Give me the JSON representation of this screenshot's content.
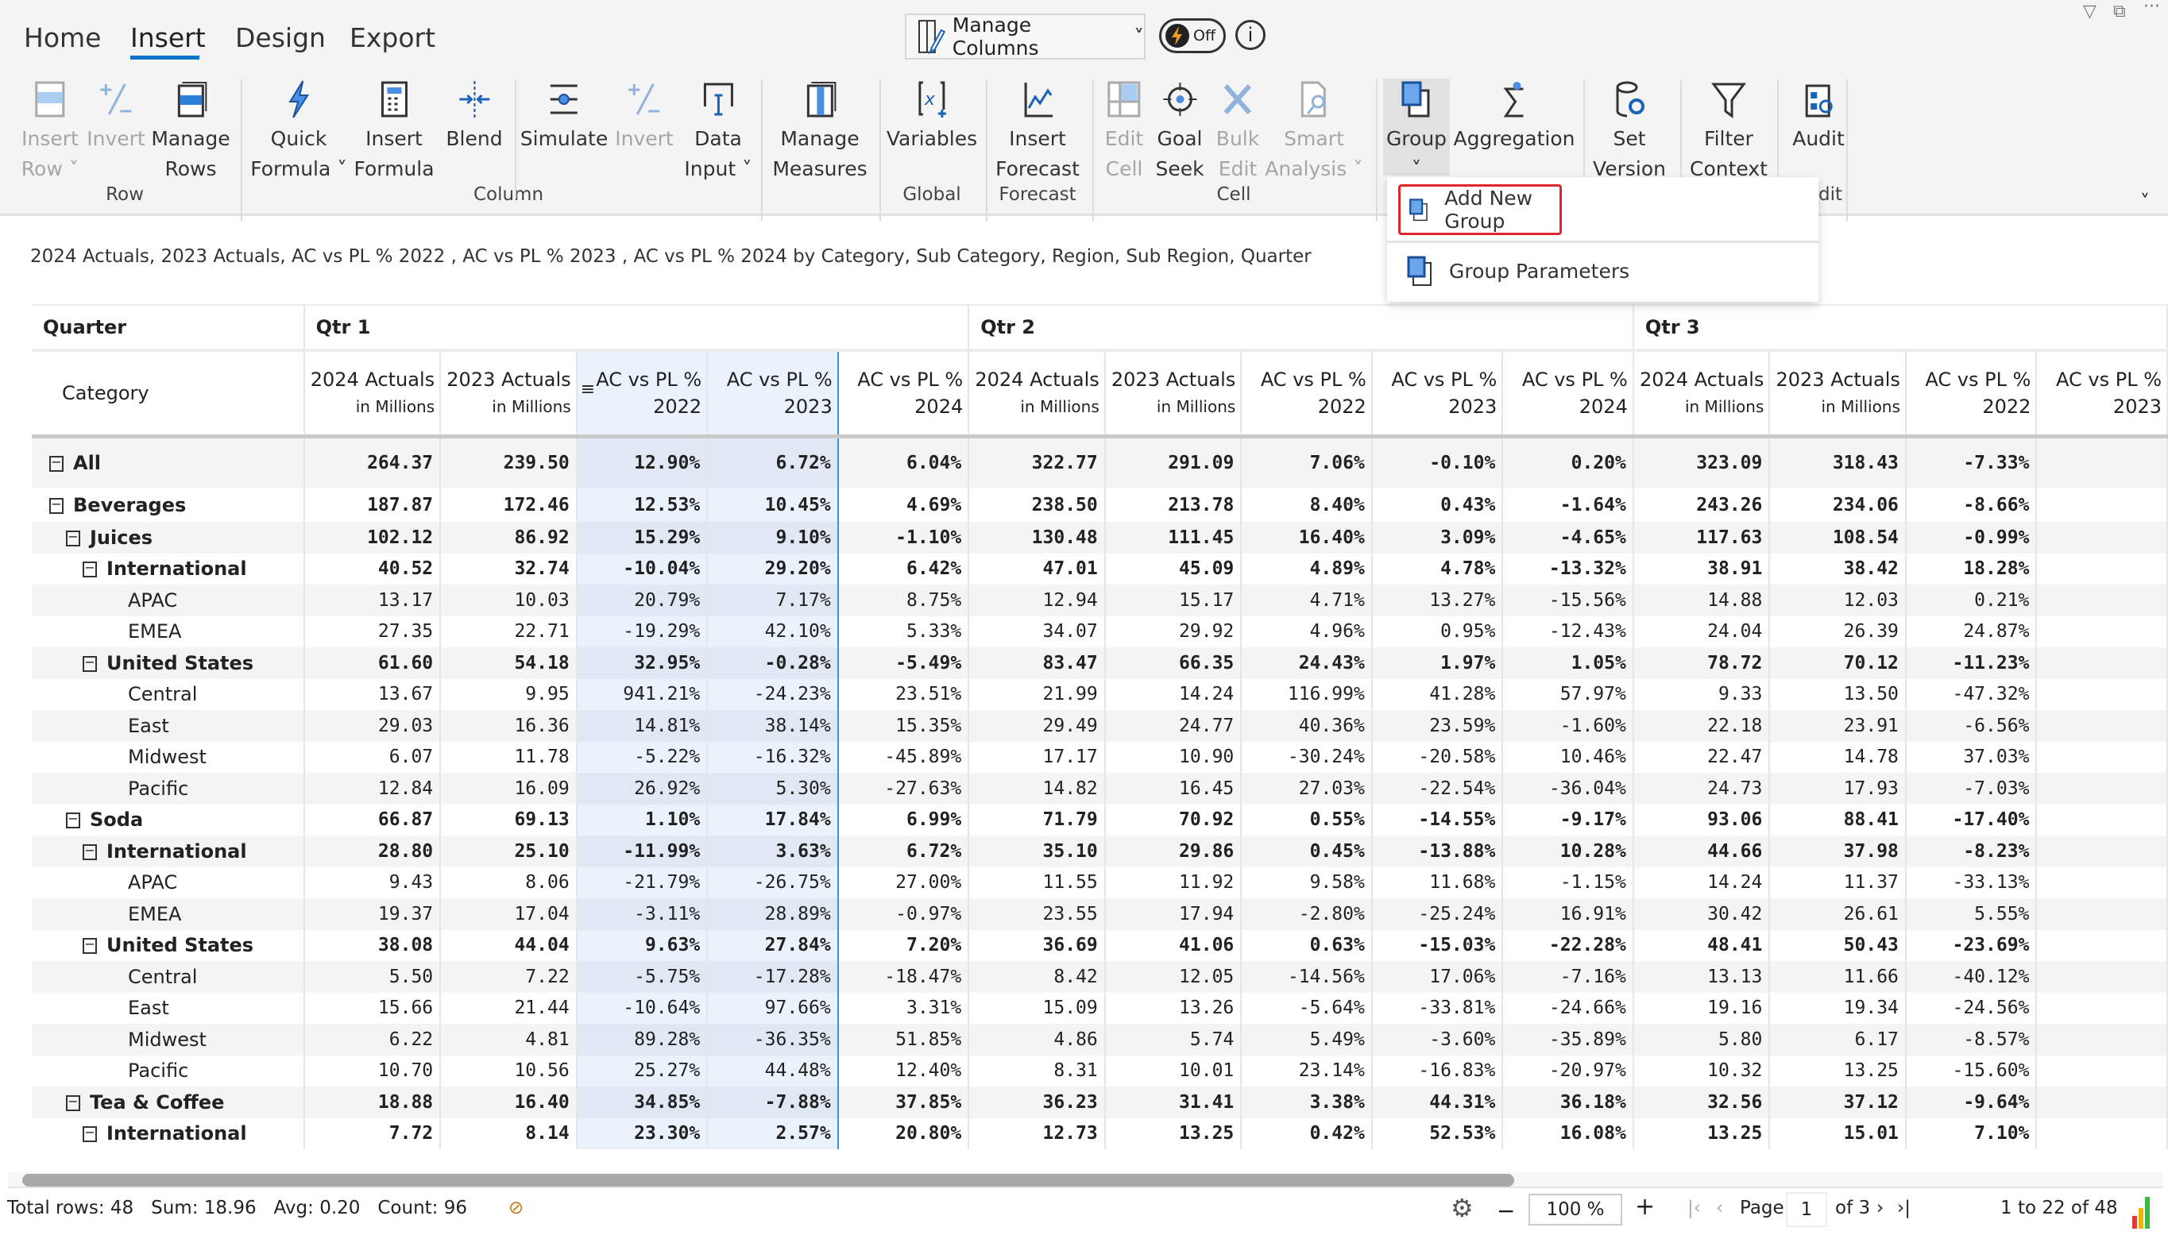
{
  "tabs": [
    "Home",
    "Insert",
    "Design",
    "Export"
  ],
  "active_tab": "Insert",
  "toolbar": {
    "manage_columns": "Manage Columns",
    "toggle_label": "Off",
    "info": "i"
  },
  "ribbon": {
    "buttons": [
      {
        "l1": "Insert",
        "l2": "Row ˅",
        "icon": "insert-row-icon",
        "disabled": true
      },
      {
        "l1": "Invert",
        "l2": "",
        "icon": "invert-icon",
        "disabled": true
      },
      {
        "l1": "Manage",
        "l2": "Rows",
        "icon": "manage-rows-icon",
        "disabled": false
      },
      {
        "l1": "Quick",
        "l2": "Formula ˅",
        "icon": "lightning-icon",
        "disabled": false
      },
      {
        "l1": "Insert",
        "l2": "Formula",
        "icon": "calculator-icon",
        "disabled": false
      },
      {
        "l1": "Blend",
        "l2": "",
        "icon": "blend-icon",
        "disabled": false
      },
      {
        "l1": "Simulate",
        "l2": "",
        "icon": "simulate-icon",
        "disabled": false
      },
      {
        "l1": "Invert",
        "l2": "",
        "icon": "invert-icon",
        "disabled": true
      },
      {
        "l1": "Data",
        "l2": "Input ˅",
        "icon": "data-input-icon",
        "disabled": false
      },
      {
        "l1": "Manage",
        "l2": "Measures",
        "icon": "manage-measures-icon",
        "disabled": false
      },
      {
        "l1": "Variables",
        "l2": "",
        "icon": "variables-icon",
        "disabled": false
      },
      {
        "l1": "Insert",
        "l2": "Forecast",
        "icon": "forecast-icon",
        "disabled": false
      },
      {
        "l1": "Edit",
        "l2": "Cell",
        "icon": "edit-cell-icon",
        "disabled": true
      },
      {
        "l1": "Goal",
        "l2": "Seek",
        "icon": "goal-seek-icon",
        "disabled": false
      },
      {
        "l1": "Bulk",
        "l2": "Edit",
        "icon": "bulk-edit-icon",
        "disabled": true
      },
      {
        "l1": "Smart",
        "l2": "Analysis ˅",
        "icon": "smart-analysis-icon",
        "disabled": true
      },
      {
        "l1": "Group",
        "l2": "˅",
        "icon": "group-icon",
        "disabled": false
      },
      {
        "l1": "Aggregation",
        "l2": "",
        "icon": "aggregation-icon",
        "disabled": false
      },
      {
        "l1": "Set",
        "l2": "Version",
        "icon": "set-version-icon",
        "disabled": false
      },
      {
        "l1": "Filter",
        "l2": "Context",
        "icon": "filter-icon",
        "disabled": false
      },
      {
        "l1": "Audit",
        "l2": "",
        "icon": "audit-icon",
        "disabled": false
      }
    ],
    "groups": [
      "Row",
      "Column",
      "Global",
      "Forecast",
      "Cell",
      "dit"
    ]
  },
  "dropdown": {
    "items": [
      "Add New Group",
      "Group Parameters"
    ]
  },
  "subtitle": "2024 Actuals, 2023 Actuals, AC vs PL % 2022 , AC vs PL % 2023 , AC vs PL % 2024 by Category, Sub Category, Region, Sub Region, Quarter",
  "table": {
    "row_header_top": "Quarter",
    "row_header": "Category",
    "quarters": [
      "Qtr 1",
      "Qtr 2",
      "Qtr 3"
    ],
    "columns": [
      {
        "l1": "2024 Actuals",
        "l2": "in Millions"
      },
      {
        "l1": "2023 Actuals",
        "l2": "in Millions"
      },
      {
        "l1": "AC vs PL %",
        "l2": "2022"
      },
      {
        "l1": "AC vs PL %",
        "l2": "2023"
      },
      {
        "l1": "AC vs PL %",
        "l2": "2024"
      }
    ],
    "rows": [
      {
        "label": "All",
        "level": 0,
        "bold": true,
        "exp": true,
        "v": [
          "264.37",
          "239.50",
          "12.90%",
          "6.72%",
          "6.04%",
          "322.77",
          "291.09",
          "7.06%",
          "-0.10%",
          "0.20%",
          "323.09",
          "318.43",
          "-7.33%"
        ]
      },
      {
        "label": "Beverages",
        "level": 0,
        "bold": true,
        "exp": true,
        "v": [
          "187.87",
          "172.46",
          "12.53%",
          "10.45%",
          "4.69%",
          "238.50",
          "213.78",
          "8.40%",
          "0.43%",
          "-1.64%",
          "243.26",
          "234.06",
          "-8.66%"
        ]
      },
      {
        "label": "Juices",
        "level": 1,
        "bold": true,
        "exp": true,
        "v": [
          "102.12",
          "86.92",
          "15.29%",
          "9.10%",
          "-1.10%",
          "130.48",
          "111.45",
          "16.40%",
          "3.09%",
          "-4.65%",
          "117.63",
          "108.54",
          "-0.99%"
        ]
      },
      {
        "label": "International",
        "level": 2,
        "bold": true,
        "exp": true,
        "v": [
          "40.52",
          "32.74",
          "-10.04%",
          "29.20%",
          "6.42%",
          "47.01",
          "45.09",
          "4.89%",
          "4.78%",
          "-13.32%",
          "38.91",
          "38.42",
          "18.28%"
        ]
      },
      {
        "label": "APAC",
        "level": 3,
        "bold": false,
        "exp": false,
        "v": [
          "13.17",
          "10.03",
          "20.79%",
          "7.17%",
          "8.75%",
          "12.94",
          "15.17",
          "4.71%",
          "13.27%",
          "-15.56%",
          "14.88",
          "12.03",
          "0.21%"
        ]
      },
      {
        "label": "EMEA",
        "level": 3,
        "bold": false,
        "exp": false,
        "v": [
          "27.35",
          "22.71",
          "-19.29%",
          "42.10%",
          "5.33%",
          "34.07",
          "29.92",
          "4.96%",
          "0.95%",
          "-12.43%",
          "24.04",
          "26.39",
          "24.87%"
        ]
      },
      {
        "label": "United States",
        "level": 2,
        "bold": true,
        "exp": true,
        "v": [
          "61.60",
          "54.18",
          "32.95%",
          "-0.28%",
          "-5.49%",
          "83.47",
          "66.35",
          "24.43%",
          "1.97%",
          "1.05%",
          "78.72",
          "70.12",
          "-11.23%"
        ]
      },
      {
        "label": "Central",
        "level": 3,
        "bold": false,
        "exp": false,
        "v": [
          "13.67",
          "9.95",
          "941.21%",
          "-24.23%",
          "23.51%",
          "21.99",
          "14.24",
          "116.99%",
          "41.28%",
          "57.97%",
          "9.33",
          "13.50",
          "-47.32%"
        ]
      },
      {
        "label": "East",
        "level": 3,
        "bold": false,
        "exp": false,
        "v": [
          "29.03",
          "16.36",
          "14.81%",
          "38.14%",
          "15.35%",
          "29.49",
          "24.77",
          "40.36%",
          "23.59%",
          "-1.60%",
          "22.18",
          "23.91",
          "-6.56%"
        ]
      },
      {
        "label": "Midwest",
        "level": 3,
        "bold": false,
        "exp": false,
        "v": [
          "6.07",
          "11.78",
          "-5.22%",
          "-16.32%",
          "-45.89%",
          "17.17",
          "10.90",
          "-30.24%",
          "-20.58%",
          "10.46%",
          "22.47",
          "14.78",
          "37.03%"
        ]
      },
      {
        "label": "Pacific",
        "level": 3,
        "bold": false,
        "exp": false,
        "v": [
          "12.84",
          "16.09",
          "26.92%",
          "5.30%",
          "-27.63%",
          "14.82",
          "16.45",
          "27.03%",
          "-22.54%",
          "-36.04%",
          "24.73",
          "17.93",
          "-7.03%"
        ]
      },
      {
        "label": "Soda",
        "level": 1,
        "bold": true,
        "exp": true,
        "v": [
          "66.87",
          "69.13",
          "1.10%",
          "17.84%",
          "6.99%",
          "71.79",
          "70.92",
          "0.55%",
          "-14.55%",
          "-9.17%",
          "93.06",
          "88.41",
          "-17.40%"
        ]
      },
      {
        "label": "International",
        "level": 2,
        "bold": true,
        "exp": true,
        "v": [
          "28.80",
          "25.10",
          "-11.99%",
          "3.63%",
          "6.72%",
          "35.10",
          "29.86",
          "0.45%",
          "-13.88%",
          "10.28%",
          "44.66",
          "37.98",
          "-8.23%"
        ]
      },
      {
        "label": "APAC",
        "level": 3,
        "bold": false,
        "exp": false,
        "v": [
          "9.43",
          "8.06",
          "-21.79%",
          "-26.75%",
          "27.00%",
          "11.55",
          "11.92",
          "9.58%",
          "11.68%",
          "-1.15%",
          "14.24",
          "11.37",
          "-33.13%"
        ]
      },
      {
        "label": "EMEA",
        "level": 3,
        "bold": false,
        "exp": false,
        "v": [
          "19.37",
          "17.04",
          "-3.11%",
          "28.89%",
          "-0.97%",
          "23.55",
          "17.94",
          "-2.80%",
          "-25.24%",
          "16.91%",
          "30.42",
          "26.61",
          "5.55%"
        ]
      },
      {
        "label": "United States",
        "level": 2,
        "bold": true,
        "exp": true,
        "v": [
          "38.08",
          "44.04",
          "9.63%",
          "27.84%",
          "7.20%",
          "36.69",
          "41.06",
          "0.63%",
          "-15.03%",
          "-22.28%",
          "48.41",
          "50.43",
          "-23.69%"
        ]
      },
      {
        "label": "Central",
        "level": 3,
        "bold": false,
        "exp": false,
        "v": [
          "5.50",
          "7.22",
          "-5.75%",
          "-17.28%",
          "-18.47%",
          "8.42",
          "12.05",
          "-14.56%",
          "17.06%",
          "-7.16%",
          "13.13",
          "11.66",
          "-40.12%"
        ]
      },
      {
        "label": "East",
        "level": 3,
        "bold": false,
        "exp": false,
        "v": [
          "15.66",
          "21.44",
          "-10.64%",
          "97.66%",
          "3.31%",
          "15.09",
          "13.26",
          "-5.64%",
          "-33.81%",
          "-24.66%",
          "19.16",
          "19.34",
          "-24.56%"
        ]
      },
      {
        "label": "Midwest",
        "level": 3,
        "bold": false,
        "exp": false,
        "v": [
          "6.22",
          "4.81",
          "89.28%",
          "-36.35%",
          "51.85%",
          "4.86",
          "5.74",
          "5.49%",
          "-3.60%",
          "-35.89%",
          "5.80",
          "6.17",
          "-8.57%"
        ]
      },
      {
        "label": "Pacific",
        "level": 3,
        "bold": false,
        "exp": false,
        "v": [
          "10.70",
          "10.56",
          "25.27%",
          "44.48%",
          "12.40%",
          "8.31",
          "10.01",
          "23.14%",
          "-16.83%",
          "-20.97%",
          "10.32",
          "13.25",
          "-15.60%"
        ]
      },
      {
        "label": "Tea & Coffee",
        "level": 1,
        "bold": true,
        "exp": true,
        "v": [
          "18.88",
          "16.40",
          "34.85%",
          "-7.88%",
          "37.85%",
          "36.23",
          "31.41",
          "3.38%",
          "44.31%",
          "36.18%",
          "32.56",
          "37.12",
          "-9.64%"
        ]
      },
      {
        "label": "International",
        "level": 2,
        "bold": true,
        "exp": true,
        "v": [
          "7.72",
          "8.14",
          "23.30%",
          "2.57%",
          "20.80%",
          "12.73",
          "13.25",
          "0.42%",
          "52.53%",
          "16.08%",
          "13.25",
          "15.01",
          "7.10%"
        ]
      }
    ]
  },
  "status": {
    "total_rows": "Total rows: 48",
    "sum": "Sum: 18.96",
    "avg": "Avg: 0.20",
    "count": "Count: 96",
    "zoom": "100 %",
    "page_label": "Page",
    "page": "1",
    "of_pages": "of 3",
    "range": "1 to 22 of 48"
  },
  "colors": {
    "accent": "#0a72c9",
    "highlight_border": "#3c8ee0",
    "dropdown_highlight": "#e0262a"
  }
}
